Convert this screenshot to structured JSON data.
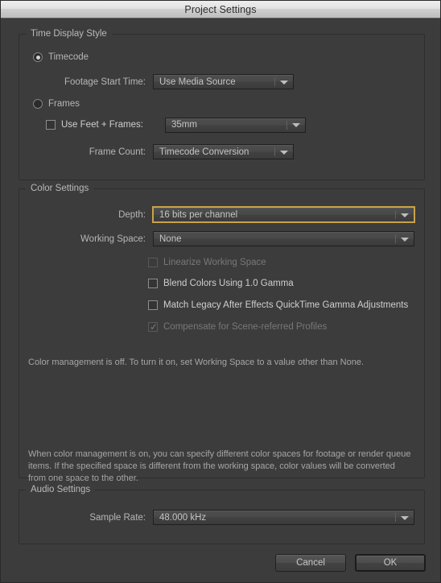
{
  "window": {
    "title": "Project Settings"
  },
  "time_display": {
    "legend": "Time Display Style",
    "timecode_label": "Timecode",
    "timecode_selected": true,
    "footage_start_time_label": "Footage Start Time:",
    "footage_start_time_value": "Use Media Source",
    "frames_label": "Frames",
    "frames_selected": false,
    "use_feet_frames_label": "Use Feet + Frames:",
    "use_feet_frames_checked": false,
    "feet_frames_value": "35mm",
    "frame_count_label": "Frame Count:",
    "frame_count_value": "Timecode Conversion"
  },
  "color_settings": {
    "legend": "Color Settings",
    "depth_label": "Depth:",
    "depth_value": "16 bits per channel",
    "working_space_label": "Working Space:",
    "working_space_value": "None",
    "checkboxes": [
      {
        "label": "Linearize Working Space",
        "checked": false,
        "enabled": false
      },
      {
        "label": "Blend Colors Using 1.0 Gamma",
        "checked": false,
        "enabled": true
      },
      {
        "label": "Match Legacy After Effects QuickTime Gamma Adjustments",
        "checked": false,
        "enabled": true
      },
      {
        "label": "Compensate for Scene-referred Profiles",
        "checked": true,
        "enabled": false
      }
    ],
    "status_text": "Color management is off. To turn it on, set Working Space to a value other than None.",
    "help_text": "When color management is on, you can specify different color spaces for footage or render queue items. If the specified space is different from the working space, color values will be converted from one space to the other."
  },
  "audio_settings": {
    "legend": "Audio Settings",
    "sample_rate_label": "Sample Rate:",
    "sample_rate_value": "48.000 kHz"
  },
  "footer": {
    "cancel_label": "Cancel",
    "ok_label": "OK"
  },
  "icons": {
    "dropdown_arrow": "chevron-down-icon",
    "checkmark": "check-icon"
  },
  "colors": {
    "window_bg": "#3c3c3c",
    "focus_accent": "#caa24a",
    "text": "#bcbcbc",
    "disabled_text": "#787878"
  }
}
